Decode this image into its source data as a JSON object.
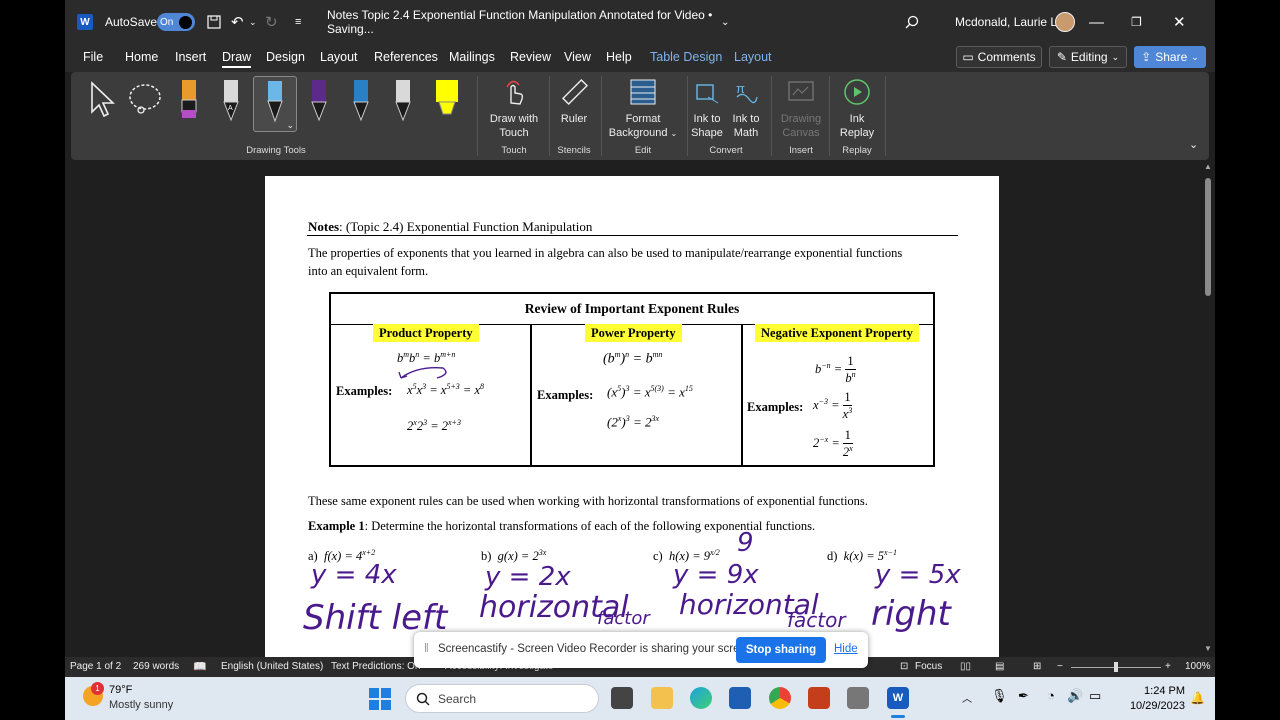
{
  "titlebar": {
    "autosave_label": "AutoSave",
    "autosave_state": "On",
    "doc_title": "Notes Topic 2.4 Exponential Function Manipulation Annotated for Video • Saving...",
    "user_name": "Mcdonald, Laurie L."
  },
  "menu": {
    "tabs": [
      "File",
      "Home",
      "Insert",
      "Draw",
      "Design",
      "Layout",
      "References",
      "Mailings",
      "Review",
      "View",
      "Help",
      "Table Design",
      "Layout"
    ],
    "active": "Draw",
    "comments": "Comments",
    "editing": "Editing",
    "share": "Share"
  },
  "ribbon": {
    "groups": {
      "drawing_tools": "Drawing Tools",
      "touch": "Touch",
      "stencils": "Stencils",
      "edit": "Edit",
      "convert": "Convert",
      "insert": "Insert",
      "replay": "Replay"
    },
    "draw_with_touch": [
      "Draw with",
      "Touch"
    ],
    "ruler": "Ruler",
    "format_background": [
      "Format",
      "Background"
    ],
    "ink_to_shape": [
      "Ink to",
      "Shape"
    ],
    "ink_to_math": [
      "Ink to",
      "Math"
    ],
    "drawing_canvas": [
      "Drawing",
      "Canvas"
    ],
    "ink_replay": [
      "Ink",
      "Replay"
    ],
    "pen_colors": [
      "#e89b2a",
      "#1b1b1b",
      "#6ab7e8",
      "#5c2a8a",
      "#2b7fc4",
      "#d9d9d9",
      "#ffff00"
    ]
  },
  "document": {
    "heading_bold": "Notes",
    "heading_rest": ": (Topic 2.4)  Exponential Function Manipulation",
    "para1_line1": "The properties of exponents that you learned in algebra can also be used to manipulate/rearrange exponential functions",
    "para1_line2": "into an equivalent form.",
    "table_title": "Review of Important Exponent Rules",
    "col1_title": "Product Property",
    "col2_title": "Power Property",
    "col3_title": "Negative Exponent Property",
    "examples_label": "Examples:",
    "para2": "These same exponent rules can be used when working with horizontal transformations of exponential functions.",
    "example1_label": "Example 1",
    "example1_text": ":  Determine the horizontal transformations of each of the following exponential functions.",
    "part_a": "a)",
    "part_b": "b)",
    "part_c": "c)",
    "part_d": "d)",
    "ink_notes": {
      "a1": "y = 4x",
      "a2": "Shift left",
      "b1": "y = 2x",
      "b2": "horizontal",
      "b3": "factor",
      "c0": "9",
      "c1": "y = 9x",
      "c2": "horizontal",
      "c3": "factor",
      "d1": "y = 5x",
      "d2": "right"
    },
    "ink_color": "#4a1a8c",
    "highlight_color": "#ffff33"
  },
  "sharebar": {
    "message": "Screencastify - Screen Video Recorder is sharing your screen.",
    "stop": "Stop sharing",
    "hide": "Hide"
  },
  "statusbar": {
    "page": "Page 1 of 2",
    "words": "269 words",
    "language": "English (United States)",
    "text_predictions": "Text Predictions: On",
    "accessibility": "Accessibility: Investigate",
    "focus": "Focus",
    "zoom": "100%"
  },
  "taskbar": {
    "weather_temp": "79°F",
    "weather_desc": "Mostly sunny",
    "weather_badge": "1",
    "search": "Search",
    "time": "1:24 PM",
    "date": "10/29/2023"
  }
}
